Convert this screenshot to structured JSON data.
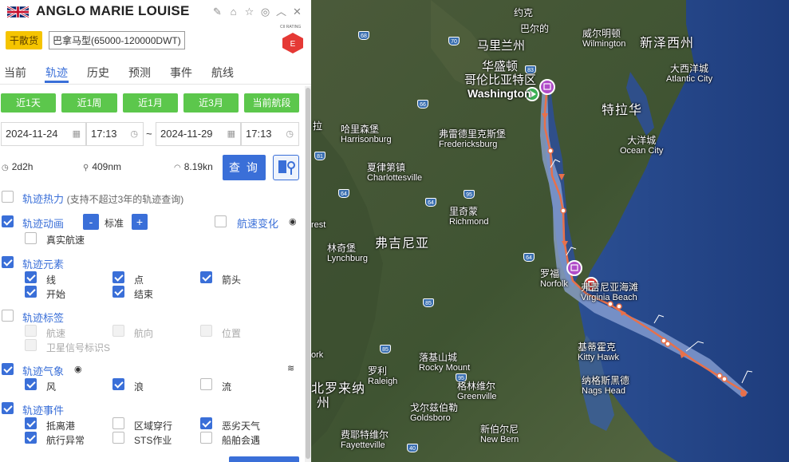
{
  "ship": {
    "name": "ANGLO MARIE LOUISE",
    "type_badge": "干散货",
    "class_badge": "巴拿马型(65000-120000DWT)",
    "cii_label": "CII RATING",
    "cii_value": "E"
  },
  "header_icons": [
    "edit-icon",
    "tag-icon",
    "star-icon",
    "target-icon",
    "collapse-icon",
    "close-icon"
  ],
  "tabs": [
    "当前",
    "轨迹",
    "历史",
    "预测",
    "事件",
    "航线"
  ],
  "active_tab": "轨迹",
  "quick_ranges": [
    "近1天",
    "近1周",
    "近1月",
    "近3月",
    "当前航段"
  ],
  "query": {
    "start_date": "2024-11-24",
    "start_time": "17:13",
    "separator": "~",
    "end_date": "2024-11-29",
    "end_time": "17:13",
    "button": "查 询"
  },
  "stats": {
    "duration": "2d2h",
    "distance": "409nm",
    "speed": "8.19kn"
  },
  "sections": {
    "heat": {
      "title": "轨迹热力",
      "note": "(支持不超过3年的轨迹查询)",
      "checked": false
    },
    "animation": {
      "title": "轨迹动画",
      "speed": "标准",
      "checked": true,
      "minus": "-",
      "plus": "+",
      "real_speed": "真实航速"
    },
    "speed_change": {
      "title": "航速变化",
      "checked": false
    },
    "elements": {
      "title": "轨迹元素",
      "checked": true,
      "items": [
        "线",
        "点",
        "箭头",
        "开始",
        "结束"
      ]
    },
    "labels": {
      "title": "轨迹标签",
      "checked": false,
      "items": [
        "航速",
        "航向",
        "位置",
        "卫星信号标识S"
      ]
    },
    "weather": {
      "title": "轨迹气象",
      "checked": true,
      "items": [
        "风",
        "浪",
        "流"
      ]
    },
    "events": {
      "title": "轨迹事件",
      "checked": true,
      "items": [
        "抵离港",
        "区域穿行",
        "恶劣天气",
        "航行异常",
        "STS作业",
        "船舶会遇"
      ]
    }
  },
  "map_labels": [
    {
      "cn": "马里兰州",
      "en": ""
    },
    {
      "cn": "华盛顿",
      "en": ""
    },
    {
      "cn": "哥伦比亚特区",
      "en": ""
    },
    {
      "cn": "",
      "en": "Washington"
    },
    {
      "cn": "威尔明顿",
      "en": "Wilmington"
    },
    {
      "cn": "新泽西州",
      "en": ""
    },
    {
      "cn": "大西洋城",
      "en": "Atlantic City"
    },
    {
      "cn": "特拉华",
      "en": ""
    },
    {
      "cn": "大洋城",
      "en": "Ocean City"
    },
    {
      "cn": "哈里森堡",
      "en": "Harrisonburg"
    },
    {
      "cn": "弗雷德里克斯堡",
      "en": "Fredericksburg"
    },
    {
      "cn": "夏律第镇",
      "en": "Charlottesville"
    },
    {
      "cn": "里奇蒙",
      "en": "Richmond"
    },
    {
      "cn": "林奇堡",
      "en": "Lynchburg"
    },
    {
      "cn": "弗吉尼亚",
      "en": ""
    },
    {
      "cn": "罗福",
      "en": "Norfolk"
    },
    {
      "cn": "弗吉尼亚海滩",
      "en": "Virginia Beach"
    },
    {
      "cn": "基蒂霍克",
      "en": "Kitty Hawk"
    },
    {
      "cn": "纳格斯黑德",
      "en": "Nags Head"
    },
    {
      "cn": "落基山城",
      "en": "Rocky Mount"
    },
    {
      "cn": "罗利",
      "en": "Raleigh"
    },
    {
      "cn": "格林维尔",
      "en": "Greenville"
    },
    {
      "cn": "戈尔兹伯勒",
      "en": "Goldsboro"
    },
    {
      "cn": "费耶特维尔",
      "en": "Fayetteville"
    },
    {
      "cn": "新伯尔尼",
      "en": "New Bern"
    },
    {
      "cn": "北罗来纳",
      "en": ""
    },
    {
      "cn": "州",
      "en": ""
    },
    {
      "cn": "约克",
      "en": ""
    },
    {
      "cn": "拉",
      "en": ""
    },
    {
      "cn": "",
      "en": "rest"
    },
    {
      "cn": "",
      "en": "ork"
    },
    {
      "cn": "巴尔的",
      "en": ""
    }
  ],
  "highway_shields": [
    "68",
    "70",
    "83",
    "66",
    "81",
    "64",
    "95",
    "64",
    "64",
    "85",
    "85",
    "95",
    "40"
  ],
  "colors": {
    "accent": "#3a6fd8",
    "quick_green": "#5cc74c",
    "type_badge": "#f5c400",
    "cii_red": "#e53935",
    "track": "#e8704a",
    "corridor": "#8fa5d8"
  }
}
